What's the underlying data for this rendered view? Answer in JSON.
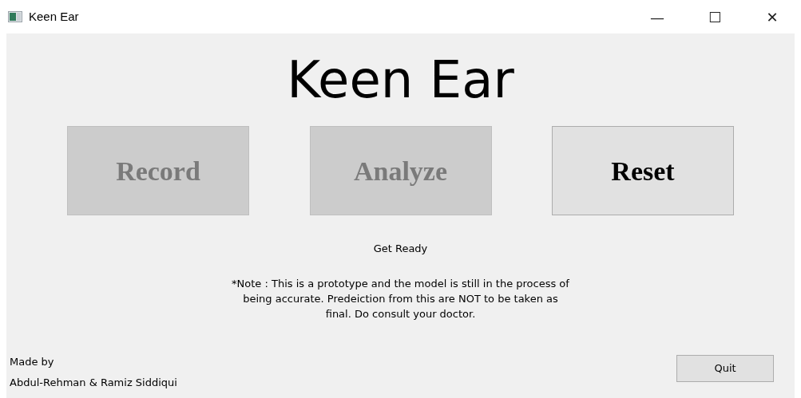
{
  "window": {
    "title": "Keen Ear",
    "controls": [
      "—",
      "☐",
      "✕"
    ]
  },
  "heading": "Keen Ear",
  "buttons": [
    {
      "label": "Record",
      "disabled": true
    },
    {
      "label": "Analyze",
      "disabled": true
    },
    {
      "label": "Reset",
      "disabled": false
    }
  ],
  "status": "Get Ready",
  "note": "*Note : This is a prototype and the model is still in the process of being accurate. Predeiction from this are NOT to be taken as final. Do consult your doctor.",
  "credits": [
    "Made by",
    "Abdul-Rehman & Ramiz Siddiqui"
  ],
  "quit_button": "Quit"
}
